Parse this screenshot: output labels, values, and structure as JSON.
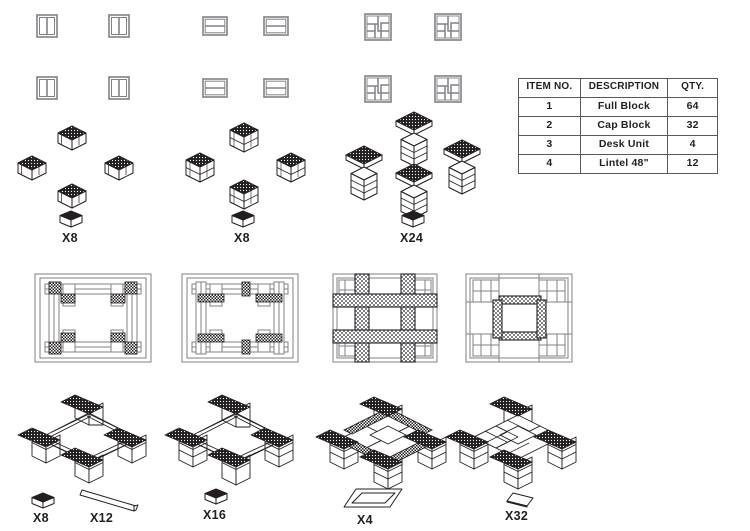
{
  "sheet": {
    "background": "#ffffff",
    "line_color": "#231f20",
    "hatch_color": "#808285",
    "fill_light": "#f1f1f1"
  },
  "parts_table": {
    "name": "bill-of-materials",
    "headers": [
      "ITEM NO.",
      "DESCRIPTION",
      "QTY."
    ],
    "rows": [
      {
        "item": "1",
        "description": "Full Block",
        "qty": "64"
      },
      {
        "item": "2",
        "description": "Cap Block",
        "qty": "32"
      },
      {
        "item": "3",
        "description": "Desk Unit",
        "qty": "4"
      },
      {
        "item": "4",
        "description": "Lintel 48\"",
        "qty": "12"
      }
    ]
  },
  "icon_rows": [
    {
      "name": "block-plan-icon-row-1",
      "icons": [
        {
          "name": "block-icon-vertical-split",
          "pattern": "vertical-split"
        },
        {
          "name": "block-icon-vertical-split",
          "pattern": "vertical-split"
        },
        {
          "name": "block-icon-horizontal-split",
          "pattern": "horizontal-split"
        },
        {
          "name": "block-icon-horizontal-split",
          "pattern": "horizontal-split"
        },
        {
          "name": "block-icon-pinwheel",
          "pattern": "pinwheel"
        },
        {
          "name": "block-icon-pinwheel",
          "pattern": "pinwheel"
        }
      ]
    },
    {
      "name": "block-plan-icon-row-2",
      "icons": [
        {
          "name": "block-icon-vertical-split",
          "pattern": "vertical-split"
        },
        {
          "name": "block-icon-vertical-split",
          "pattern": "vertical-split"
        },
        {
          "name": "block-icon-horizontal-split",
          "pattern": "horizontal-split"
        },
        {
          "name": "block-icon-horizontal-split",
          "pattern": "horizontal-split"
        },
        {
          "name": "block-icon-pinwheel",
          "pattern": "pinwheel"
        },
        {
          "name": "block-icon-pinwheel",
          "pattern": "pinwheel"
        }
      ]
    }
  ],
  "post_groups": [
    {
      "name": "post-group-1",
      "qty_label": "X8",
      "stack_height": 1,
      "legend_part": "full-block"
    },
    {
      "name": "post-group-2",
      "qty_label": "X8",
      "stack_height": 2,
      "legend_part": "full-block"
    },
    {
      "name": "post-group-3",
      "qty_label": "X24",
      "stack_height": 4,
      "legend_part": "full-block"
    }
  ],
  "plan_views": [
    {
      "name": "plan-view-step-1",
      "style": "corner-posts-thin-lintels"
    },
    {
      "name": "plan-view-step-2",
      "style": "corner-posts-thin-lintels"
    },
    {
      "name": "plan-view-step-3",
      "style": "cross-beams-heavy"
    },
    {
      "name": "plan-view-step-4",
      "style": "center-frame"
    }
  ],
  "assemblies": [
    {
      "name": "assembly-step-1",
      "legend": [
        {
          "name": "legend-full-block",
          "part": "full-block",
          "qty_label": "X8"
        },
        {
          "name": "legend-lintel",
          "part": "lintel",
          "qty_label": "X12"
        }
      ]
    },
    {
      "name": "assembly-step-2",
      "legend": [
        {
          "name": "legend-full-block",
          "part": "full-block",
          "qty_label": "X16"
        }
      ]
    },
    {
      "name": "assembly-step-3",
      "legend": [
        {
          "name": "legend-desk-unit",
          "part": "desk-unit",
          "qty_label": "X4"
        }
      ]
    },
    {
      "name": "assembly-step-4",
      "legend": [
        {
          "name": "legend-cap-block",
          "part": "cap-block",
          "qty_label": "X32"
        }
      ]
    }
  ]
}
